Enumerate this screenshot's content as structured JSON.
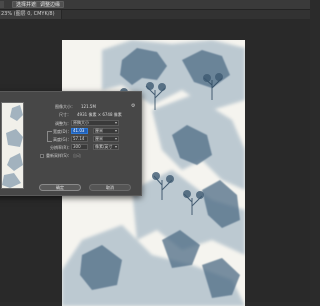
{
  "toolbar": {
    "btn1_label": "选择并遮住...",
    "btn2_label": "调整边缘"
  },
  "document_tab": {
    "label": "23% (图层 0, CMYK/8)"
  },
  "dialog": {
    "image_size_label": "图像大小：",
    "image_size_value": "121.5M",
    "dimensions_label": "尺寸：",
    "dimensions_value": "4931 像素 × 6748 像素",
    "fit_label": "调整为：",
    "fit_value": "原稿大小",
    "width_label": "宽度(D)：",
    "width_value": "41.03",
    "width_unit": "厘米",
    "height_label": "高度(G)：",
    "height_value": "57.14",
    "height_unit": "厘米",
    "resolution_label": "分辨率(R)：",
    "resolution_value": "300",
    "resolution_unit": "像素/英寸",
    "resample_label": "重新采样(S)：",
    "resample_value": "自动",
    "ok_label": "确定",
    "cancel_label": "取消"
  },
  "icons": [
    "gear-icon",
    "chain-link-icon",
    "chevron-down-icon",
    "checkbox-icon"
  ],
  "colors": {
    "app_bg": "#2b2b2b",
    "dialog_bg": "#474747",
    "active_field": "#1f5fb8",
    "canvas_bg": "#f5f4ef",
    "ink_blue": "#5f7d96"
  }
}
